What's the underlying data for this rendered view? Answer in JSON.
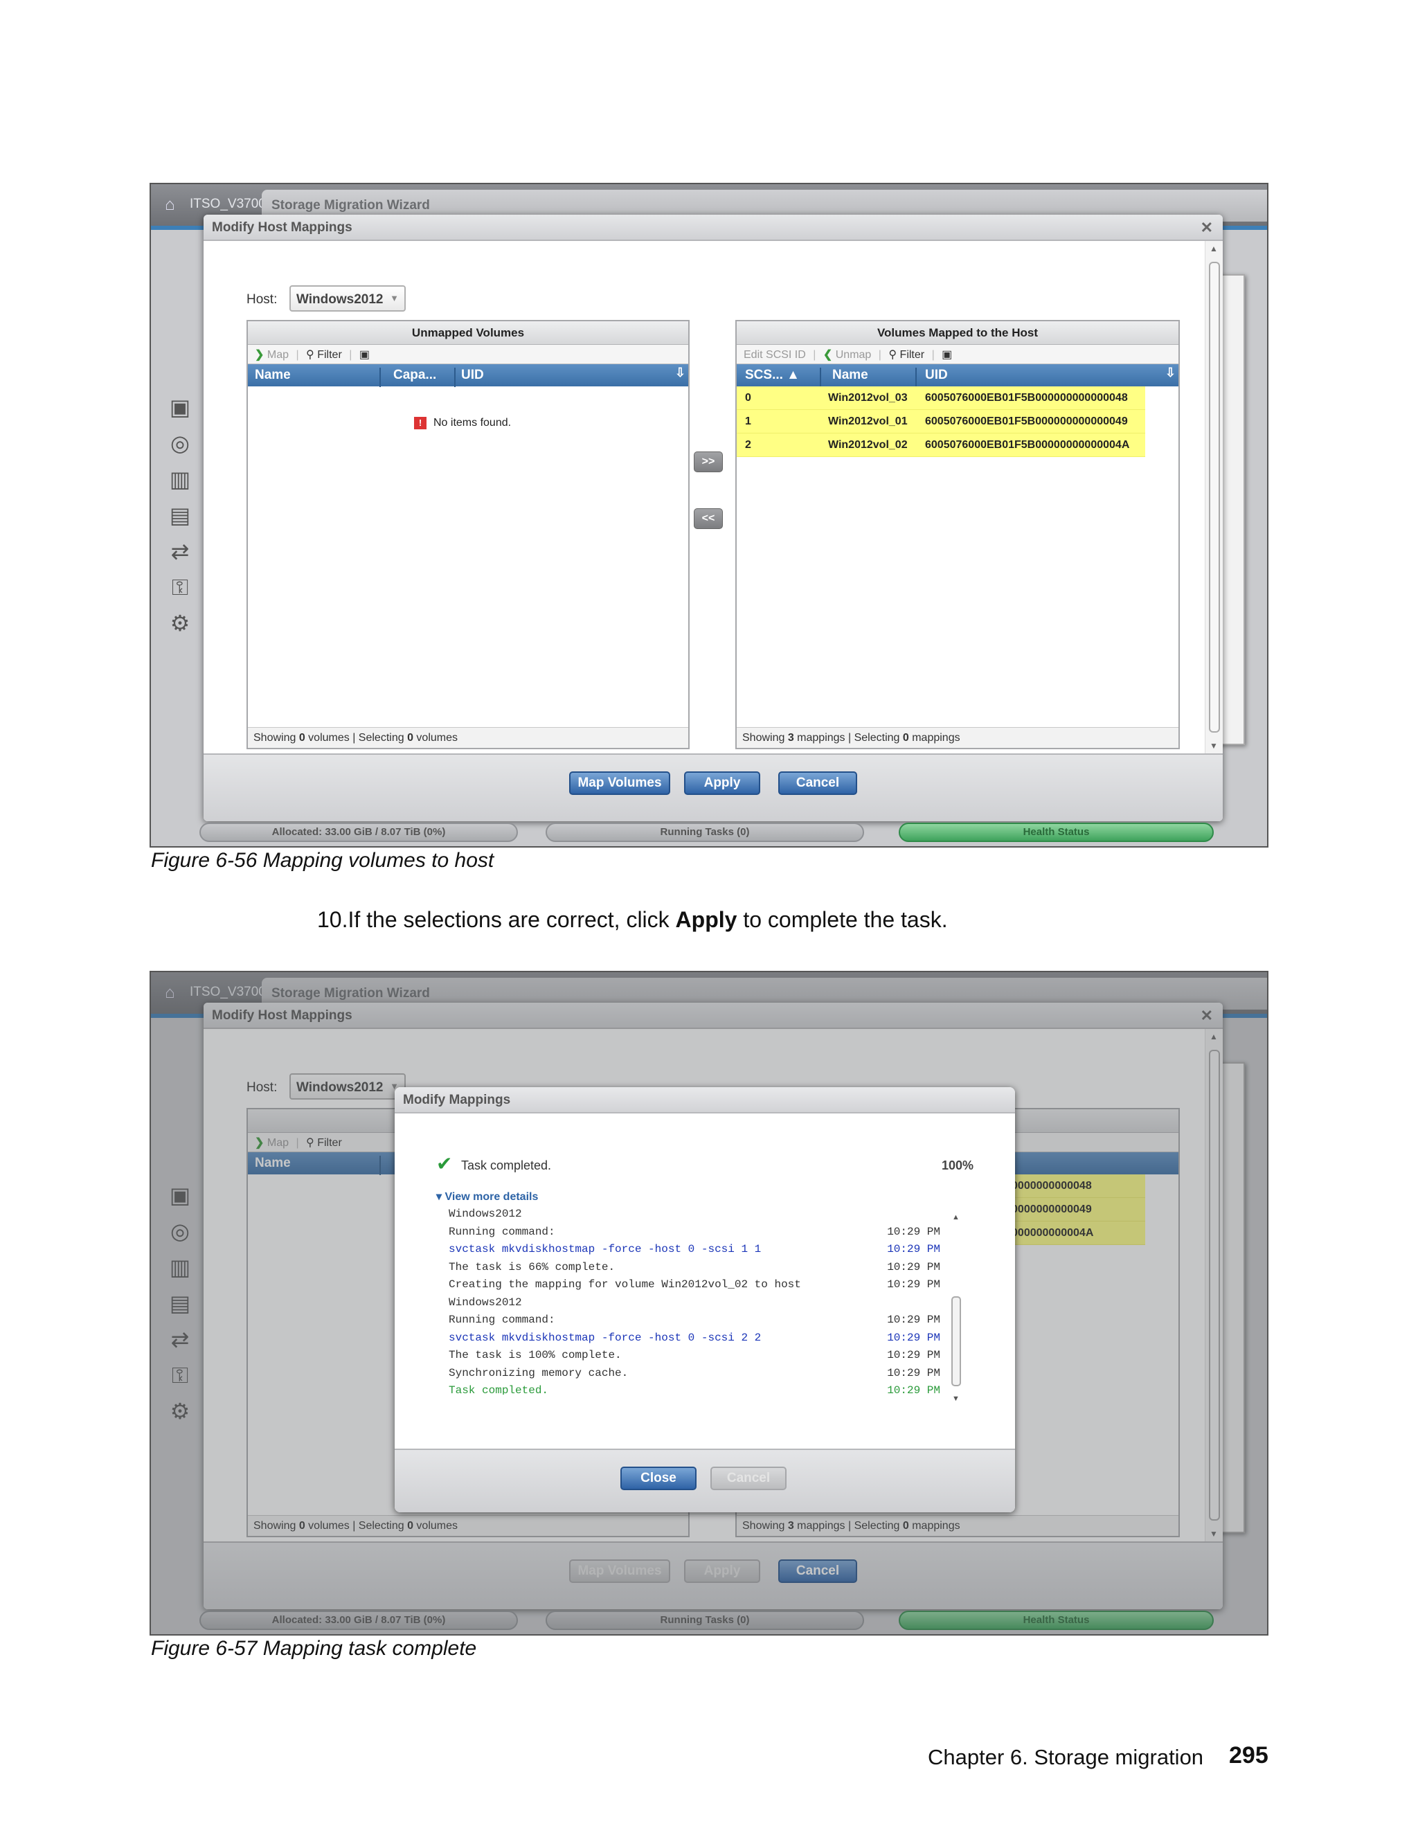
{
  "common": {
    "system_name": "ITSO_V3700",
    "wizard_title": "Storage Migration Wizard",
    "dialog_title": "Modify Host Mappings",
    "host_label": "Host:",
    "host_value": "Windows2012",
    "allocated": "Allocated: 33.00 GiB / 8.07 TiB (0%)",
    "running_tasks": "Running Tasks (0)",
    "health_status": "Health Status",
    "btn_map_volumes": "Map Volumes",
    "btn_apply": "Apply",
    "btn_cancel": "Cancel",
    "btn_move_right": ">>",
    "btn_move_left": "<<"
  },
  "left_panel": {
    "title": "Unmapped Volumes",
    "tool_map": "Map",
    "tool_filter": "Filter",
    "columns": [
      "Name",
      "Capa...",
      "UID"
    ],
    "empty_message": "No items found.",
    "footer_prefix": "Showing ",
    "footer_count": "0",
    "footer_mid": " volumes | Selecting ",
    "footer_sel": "0",
    "footer_suffix": " volumes"
  },
  "right_panel": {
    "title": "Volumes Mapped to the Host",
    "tool_edit": "Edit SCSI ID",
    "tool_unmap": "Unmap",
    "tool_filter": "Filter",
    "columns": [
      "SCS...",
      "Name",
      "UID"
    ],
    "rows": [
      {
        "scsi": "0",
        "name": "Win2012vol_03",
        "uid": "6005076000EB01F5B000000000000048"
      },
      {
        "scsi": "1",
        "name": "Win2012vol_01",
        "uid": "6005076000EB01F5B000000000000049"
      },
      {
        "scsi": "2",
        "name": "Win2012vol_02",
        "uid": "6005076000EB01F5B00000000000004A"
      }
    ],
    "footer_prefix": "Showing ",
    "footer_count": "3",
    "footer_mid": " mappings | Selecting ",
    "footer_sel": "0",
    "footer_suffix": " mappings"
  },
  "modal": {
    "title": "Modify Mappings",
    "status": "Task completed.",
    "progress": "100%",
    "details_link": "View more details",
    "log": [
      {
        "text": "Windows2012",
        "time": "",
        "style": ""
      },
      {
        "text": "Running command:",
        "time": "10:29 PM",
        "style": ""
      },
      {
        "text": "svctask mkvdiskhostmap -force -host 0 -scsi 1 1",
        "time": "10:29 PM",
        "style": "blue"
      },
      {
        "text": "The task is 66% complete.",
        "time": "10:29 PM",
        "style": ""
      },
      {
        "text": "Creating the mapping for volume Win2012vol_02 to host",
        "time": "10:29 PM",
        "style": ""
      },
      {
        "text": "Windows2012",
        "time": "",
        "style": ""
      },
      {
        "text": "Running command:",
        "time": "10:29 PM",
        "style": ""
      },
      {
        "text": "svctask mkvdiskhostmap -force -host 0 -scsi 2 2",
        "time": "10:29 PM",
        "style": "blue"
      },
      {
        "text": "The task is 100% complete.",
        "time": "10:29 PM",
        "style": ""
      },
      {
        "text": "Synchronizing memory cache.",
        "time": "10:29 PM",
        "style": ""
      },
      {
        "text": "Task completed.",
        "time": "10:29 PM",
        "style": "green"
      }
    ],
    "btn_close": "Close",
    "btn_cancel": "Cancel"
  },
  "doc": {
    "caption1": "Figure 6-56   Mapping volumes to host",
    "step_prefix": "10.If the selections are correct, click ",
    "step_bold": "Apply",
    "step_suffix": " to complete the task.",
    "caption2": "Figure 6-57   Mapping task complete",
    "footer_chapter": "Chapter 6. Storage migration",
    "page_number": "295"
  }
}
